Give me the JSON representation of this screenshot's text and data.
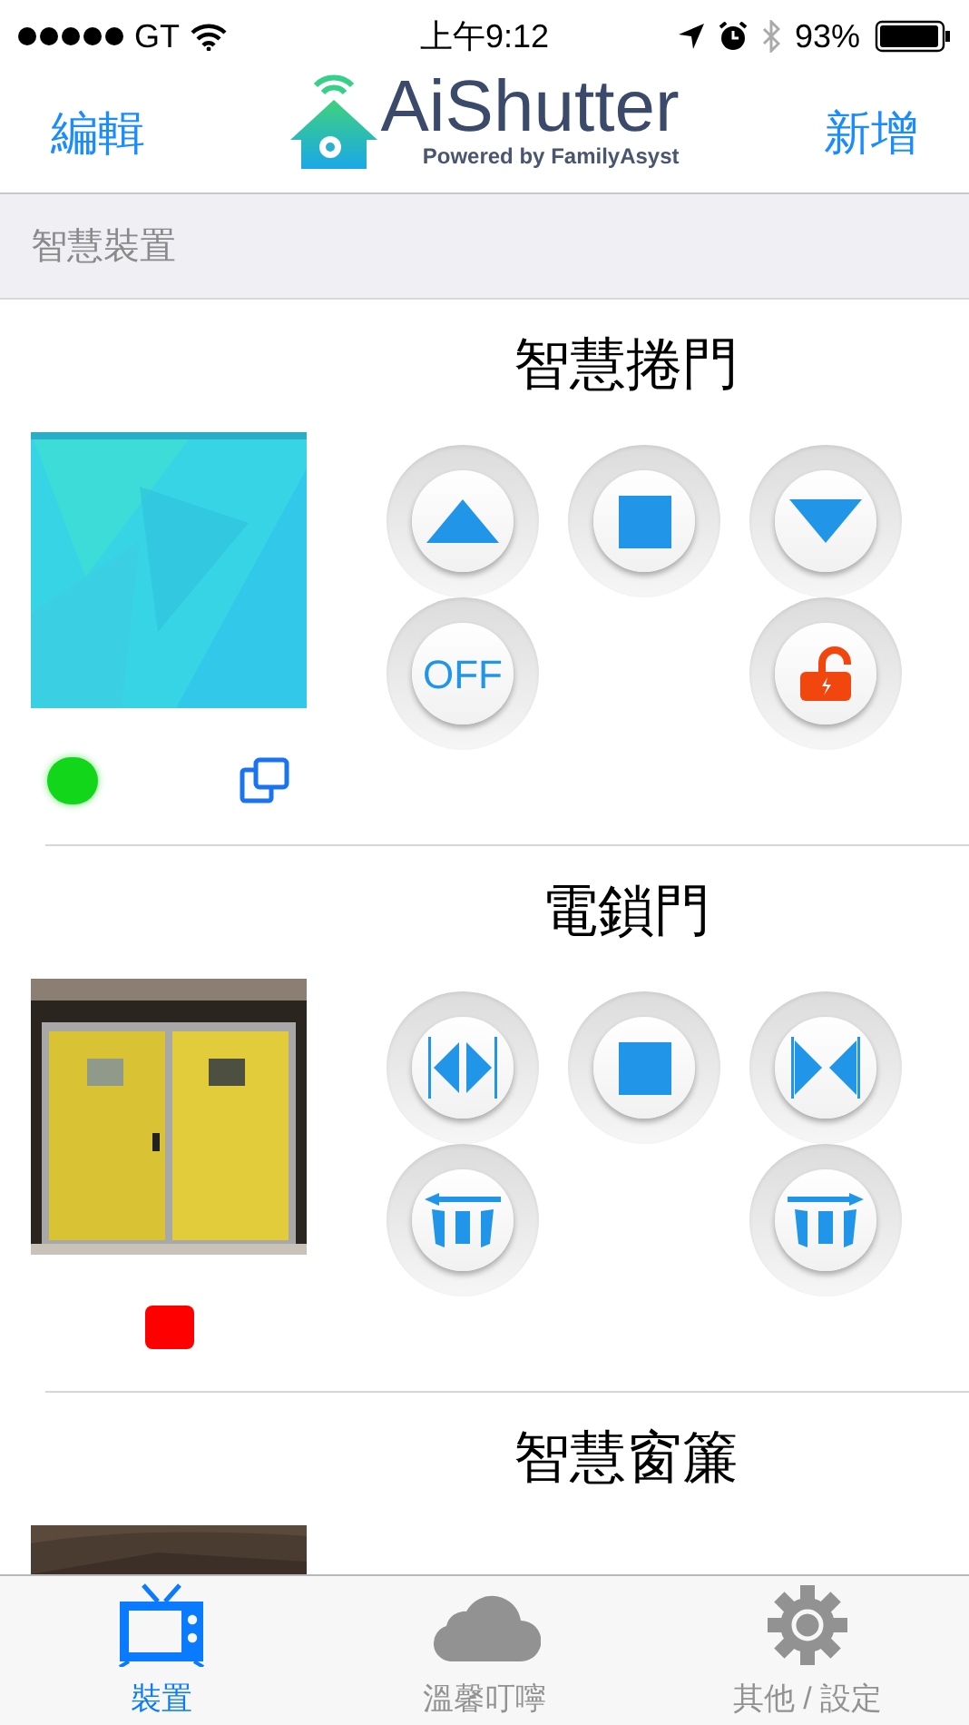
{
  "status_bar": {
    "carrier": "GT",
    "time": "上午9:12",
    "battery": "93%"
  },
  "header": {
    "left_button": "編輯",
    "logo_title": "AiShutter",
    "logo_subtitle": "Powered by FamilyAsyst",
    "right_button": "新增"
  },
  "section_title": "智慧裝置",
  "devices": [
    {
      "name": "智慧捲門",
      "controls": [
        [
          {
            "kind": "up"
          },
          {
            "kind": "stop"
          },
          {
            "kind": "down"
          }
        ],
        [
          {
            "kind": "text",
            "label": "OFF"
          },
          {
            "kind": "unlock"
          }
        ]
      ],
      "indicators": [
        {
          "kind": "dot",
          "color": "#11d61a"
        },
        {
          "kind": "copy"
        }
      ]
    },
    {
      "name": "電鎖門",
      "controls": [
        [
          {
            "kind": "open"
          },
          {
            "kind": "stop"
          },
          {
            "kind": "close"
          }
        ],
        [
          {
            "kind": "slide_left"
          },
          {
            "kind": "slide_right"
          }
        ]
      ],
      "indicators": [
        {
          "kind": "square",
          "color": "#ff0000"
        }
      ]
    },
    {
      "name": "智慧窗簾"
    }
  ],
  "tabs": [
    {
      "label": "裝置",
      "kind": "tv",
      "selected": true
    },
    {
      "label": "溫馨叮嚀",
      "kind": "cloud",
      "selected": false
    },
    {
      "label": "其他 / 設定",
      "kind": "gear",
      "selected": false
    }
  ]
}
